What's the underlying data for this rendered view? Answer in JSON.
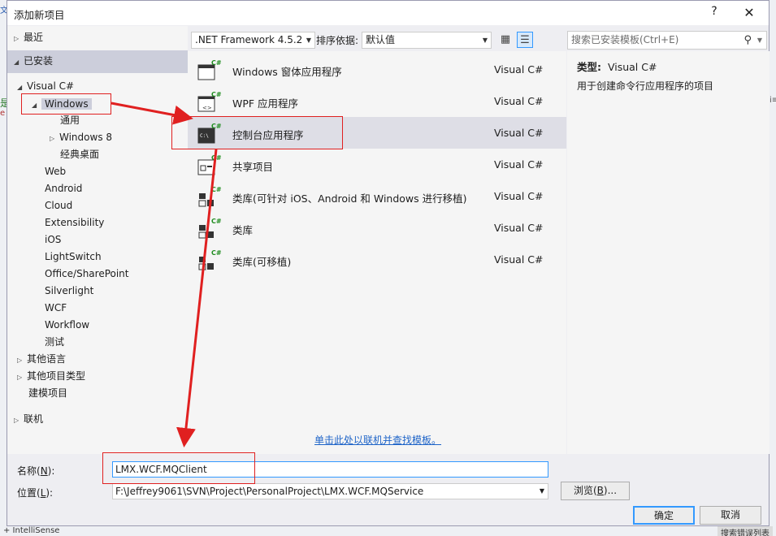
{
  "background": {
    "left_fragments": [
      "文",
      "是",
      "e"
    ],
    "right_fragment": "i≡",
    "bottom_left": "+ IntelliSense",
    "bottom_right": "搜索错误列表"
  },
  "dialog": {
    "title": "添加新项目",
    "help": "?",
    "close": "✕"
  },
  "nav": {
    "recent": "最近",
    "installed": "已安装",
    "visual_csharp": "Visual C#",
    "windows": "Windows",
    "general": "通用",
    "windows8": "Windows 8",
    "classic_desktop": "经典桌面",
    "web": "Web",
    "android": "Android",
    "cloud": "Cloud",
    "extensibility": "Extensibility",
    "ios": "iOS",
    "lightswitch": "LightSwitch",
    "office": "Office/SharePoint",
    "silverlight": "Silverlight",
    "wcf": "WCF",
    "workflow": "Workflow",
    "test": "测试",
    "other_languages": "其他语言",
    "other_project_types": "其他项目类型",
    "modeling": "建模项目",
    "online": "联机"
  },
  "toolbar": {
    "framework": ".NET Framework 4.5.2",
    "sort_label": "排序依据:",
    "sort_value": "默认值",
    "search_placeholder": "搜索已安装模板(Ctrl+E)"
  },
  "templates": [
    {
      "name": "Windows 窗体应用程序",
      "lang": "Visual C#"
    },
    {
      "name": "WPF 应用程序",
      "lang": "Visual C#"
    },
    {
      "name": "控制台应用程序",
      "lang": "Visual C#"
    },
    {
      "name": "共享项目",
      "lang": "Visual C#"
    },
    {
      "name": "类库(可针对 iOS、Android 和 Windows 进行移植)",
      "lang": "Visual C#"
    },
    {
      "name": "类库",
      "lang": "Visual C#"
    },
    {
      "name": "类库(可移植)",
      "lang": "Visual C#"
    }
  ],
  "icon_badge": "C#",
  "console_icon_text": "C:\\",
  "online_link": "单击此处以联机并查找模板。",
  "description": {
    "type_label": "类型:",
    "type_value": "Visual C#",
    "text": "用于创建命令行应用程序的项目"
  },
  "form": {
    "name_label": "名称(",
    "name_key": "N",
    "name_label_end": "):",
    "name_value": "LMX.WCF.MQClient",
    "location_label": "位置(",
    "location_key": "L",
    "location_label_end": "):",
    "location_value": "F:\\Jeffrey9061\\SVN\\Project\\PersonalProject\\LMX.WCF.MQService",
    "browse_label": "浏览(",
    "browse_key": "B",
    "browse_label_end": ")...",
    "ok": "确定",
    "cancel": "取消"
  },
  "colors": {
    "accent": "#3399ff",
    "selected_bg": "#cccedb",
    "annotation": "#e02020",
    "badge": "#1e8c1e",
    "link": "#1e64c8"
  }
}
